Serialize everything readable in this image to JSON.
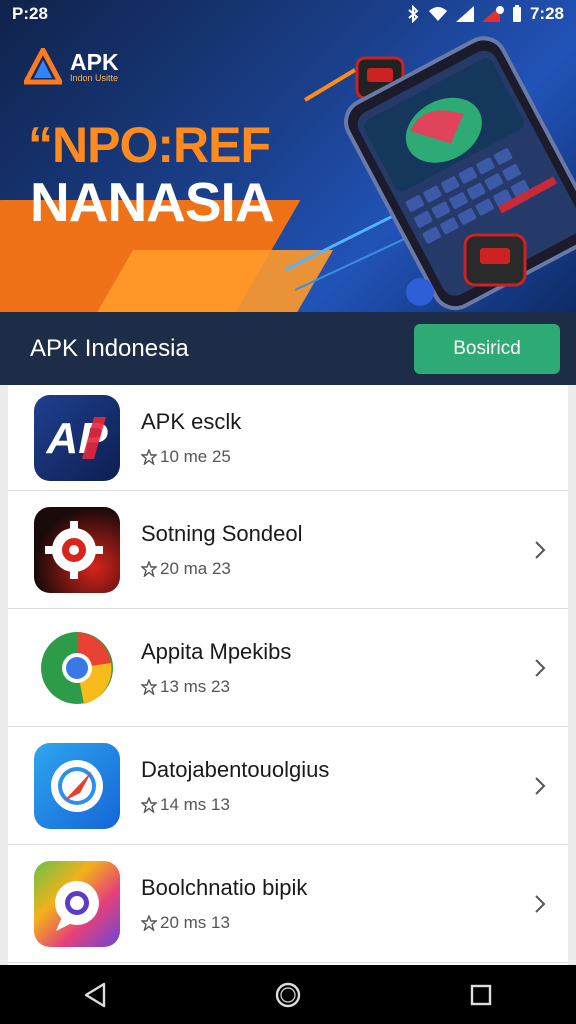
{
  "status_bar": {
    "time": "P:28",
    "clock": "7:28"
  },
  "banner": {
    "logo_title": "APK",
    "logo_subtitle": "Indon Usitte",
    "headline_line1": "“NPO:REF",
    "headline_line2": "NANASIA"
  },
  "app_bar": {
    "title": "APK Indonesia",
    "download_label": "Bosiricd"
  },
  "apps": [
    {
      "name": "APK esclk",
      "meta": "10 me  25",
      "icon": "ap-logo-icon"
    },
    {
      "name": "Sotning Sondeol",
      "meta": "20 ma  23",
      "icon": "gear-icon"
    },
    {
      "name": "Appita Mpekibs",
      "meta": "13 ms  23",
      "icon": "chrome-icon"
    },
    {
      "name": "Datojabentouolgius",
      "meta": "14 ms  13",
      "icon": "compass-icon"
    },
    {
      "name": "Boolchnatio bipik",
      "meta": "20 ms  13",
      "icon": "chat-bubble-icon"
    }
  ],
  "colors": {
    "accent": "#2eaa74",
    "header": "#1d2d48",
    "orange": "#f07218"
  }
}
